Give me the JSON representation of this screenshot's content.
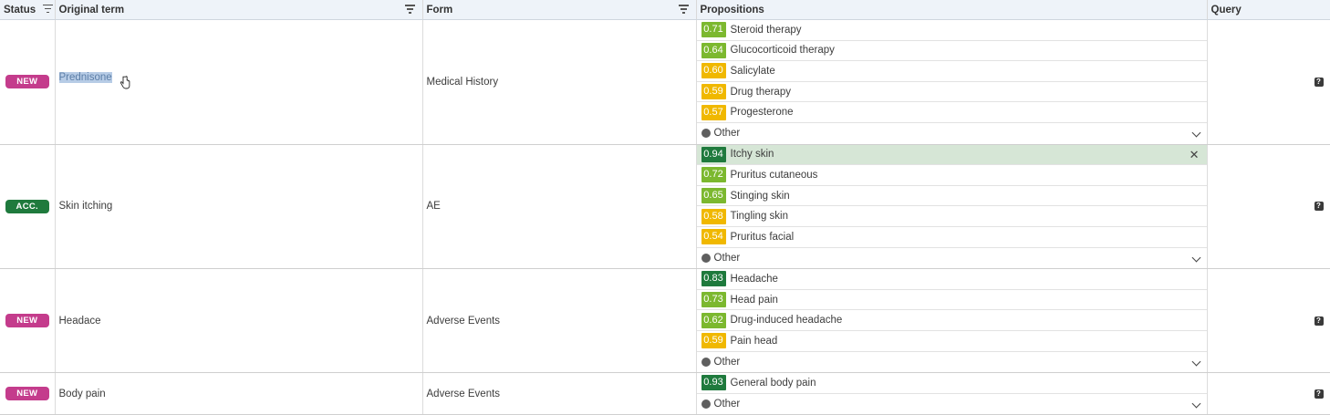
{
  "colors": {
    "new_badge": "#c43c8c",
    "acc_badge": "#1f7a3d",
    "score_high": "#1f7a3d",
    "score_mid": "#7cb82f",
    "score_low": "#f0b800",
    "selected_row": "#d6e6d6",
    "header_bg": "#eef3f9"
  },
  "header": {
    "status": "Status",
    "original_term": "Original term",
    "form": "Form",
    "propositions": "Propositions",
    "query": "Query"
  },
  "rows": [
    {
      "status": "NEW",
      "status_type": "new",
      "term": "Prednisone",
      "term_selected": true,
      "form": "Medical History",
      "propositions": [
        {
          "score": "0.71",
          "level": "mid",
          "label": "Steroid therapy"
        },
        {
          "score": "0.64",
          "level": "mid",
          "label": "Glucocorticoid therapy"
        },
        {
          "score": "0.60",
          "level": "low",
          "label": "Salicylate"
        },
        {
          "score": "0.59",
          "level": "low",
          "label": "Drug therapy"
        },
        {
          "score": "0.57",
          "level": "low",
          "label": "Progesterone"
        }
      ],
      "other_label": "Other",
      "query_icon": "question-icon"
    },
    {
      "status": "ACC.",
      "status_type": "acc",
      "term": "Skin itching",
      "form": "AE",
      "propositions": [
        {
          "score": "0.94",
          "level": "high",
          "label": "Itchy skin",
          "selected": true
        },
        {
          "score": "0.72",
          "level": "mid",
          "label": "Pruritus cutaneous"
        },
        {
          "score": "0.65",
          "level": "mid",
          "label": "Stinging skin"
        },
        {
          "score": "0.58",
          "level": "low",
          "label": "Tingling skin"
        },
        {
          "score": "0.54",
          "level": "low",
          "label": "Pruritus facial"
        }
      ],
      "other_label": "Other",
      "query_icon": "question-icon"
    },
    {
      "status": "NEW",
      "status_type": "new",
      "term": "Headace",
      "form": "Adverse Events",
      "propositions": [
        {
          "score": "0.83",
          "level": "high",
          "label": "Headache"
        },
        {
          "score": "0.73",
          "level": "mid",
          "label": "Head pain"
        },
        {
          "score": "0.62",
          "level": "mid",
          "label": "Drug-induced headache"
        },
        {
          "score": "0.59",
          "level": "low",
          "label": "Pain head"
        }
      ],
      "other_label": "Other",
      "query_icon": "question-icon"
    },
    {
      "status": "NEW",
      "status_type": "new",
      "term": "Body pain",
      "form": "Adverse Events",
      "propositions": [
        {
          "score": "0.93",
          "level": "high",
          "label": "General body pain"
        }
      ],
      "other_label": "Other",
      "query_icon": "question-icon"
    }
  ]
}
